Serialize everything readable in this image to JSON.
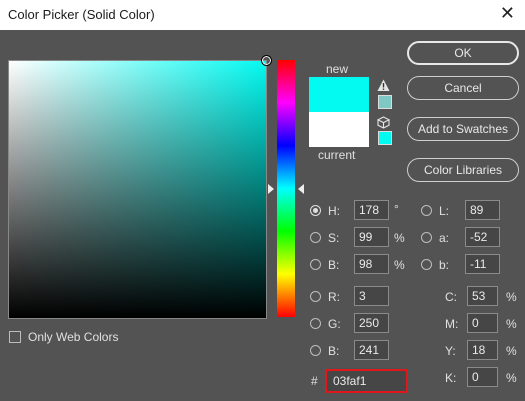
{
  "window": {
    "title": "Color Picker (Solid Color)",
    "close_glyph": "✕"
  },
  "preview": {
    "new_label": "new",
    "current_label": "current",
    "new_color": "#03faf1",
    "current_color": "#ffffff"
  },
  "buttons": {
    "ok": "OK",
    "cancel": "Cancel",
    "add_to_swatches": "Add to Swatches",
    "color_libraries": "Color Libraries"
  },
  "hsb": {
    "h": {
      "label": "H:",
      "value": "178",
      "unit": "°"
    },
    "s": {
      "label": "S:",
      "value": "99",
      "unit": "%"
    },
    "b": {
      "label": "B:",
      "value": "98",
      "unit": "%"
    }
  },
  "lab": {
    "l": {
      "label": "L:",
      "value": "89"
    },
    "a": {
      "label": "a:",
      "value": "-52"
    },
    "b": {
      "label": "b:",
      "value": "-11"
    }
  },
  "rgb": {
    "r": {
      "label": "R:",
      "value": "3"
    },
    "g": {
      "label": "G:",
      "value": "250"
    },
    "b": {
      "label": "B:",
      "value": "241"
    }
  },
  "cmyk": {
    "c": {
      "label": "C:",
      "value": "53",
      "unit": "%"
    },
    "m": {
      "label": "M:",
      "value": "0",
      "unit": "%"
    },
    "y": {
      "label": "Y:",
      "value": "18",
      "unit": "%"
    },
    "k": {
      "label": "K:",
      "value": "0",
      "unit": "%"
    }
  },
  "hex": {
    "label": "#",
    "value": "03faf1"
  },
  "web_colors": {
    "label": "Only Web Colors",
    "checked": false
  },
  "icons": {
    "warning": "warning-icon",
    "cube": "cube-icon"
  },
  "colors": {
    "selected": "#03faf1",
    "hex_highlight": "#e0181c",
    "background": "#535353"
  }
}
